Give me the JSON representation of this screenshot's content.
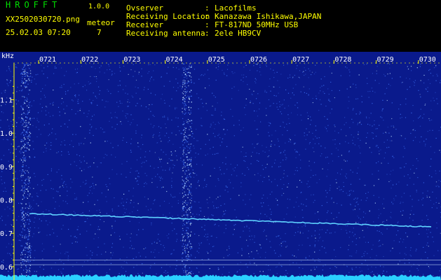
{
  "header": {
    "app_title": "HROFFT",
    "version": "1.0.0",
    "filename": "XX2502030720.png",
    "datetime": "25.02.03 07:20",
    "meteor_label": "meteor",
    "meteor_count": "7",
    "info": [
      {
        "label": "Ovserver",
        "value": "Lacofilms"
      },
      {
        "label": "Receiving Location",
        "value": "Kanazawa Ishikawa,JAPAN"
      },
      {
        "label": "Receiver",
        "value": "FT-817ND 50MHz USB"
      },
      {
        "label": "Receiving antenna",
        "value": "2ele HB9CV"
      }
    ]
  },
  "spectrogram": {
    "unit_label": "kHz",
    "y_ticks": [
      "1.1",
      "1.0",
      "0.9",
      "0.8",
      "0.7",
      "0.6"
    ],
    "y_tick_values": [
      1.1,
      1.0,
      0.9,
      0.8,
      0.7,
      0.6
    ],
    "y_range": [
      0.56,
      1.21
    ],
    "time_labels": [
      "0721",
      "0722",
      "0723",
      "0724",
      "0725",
      "0726",
      "0727",
      "0728",
      "0729",
      "0730"
    ],
    "colors": {
      "background": "#0a1a8c",
      "noise": "#3a6cf0",
      "bright": "#bfe3ff",
      "trace": "#5fd3ff",
      "marker": "#ffff00",
      "baseline": "#2ad0ff",
      "guide_line": "#cfe7ff"
    }
  }
}
